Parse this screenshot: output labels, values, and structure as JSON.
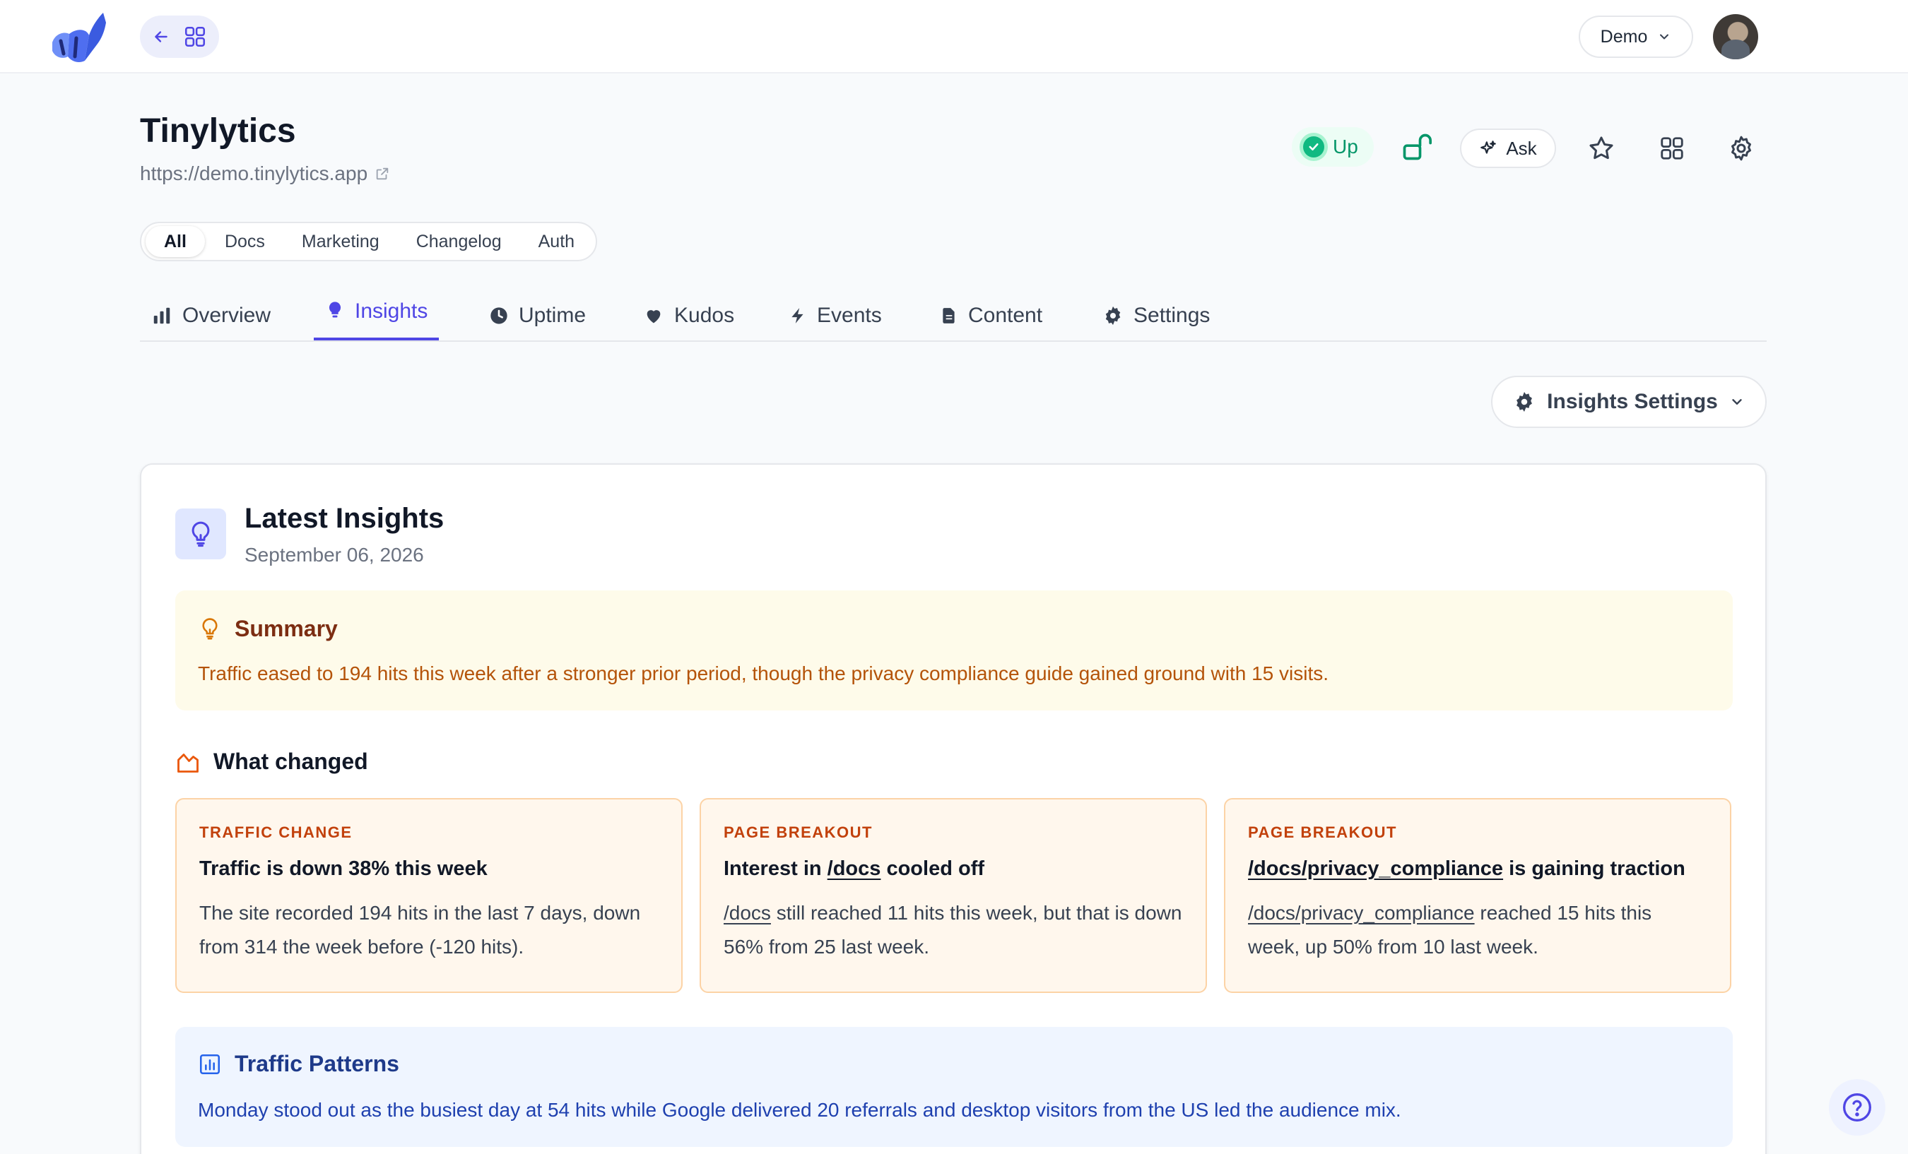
{
  "topbar": {
    "workspace": "Demo"
  },
  "site": {
    "title": "Tinylytics",
    "url": "https://demo.tinylytics.app",
    "status": "Up",
    "ask_label": "Ask"
  },
  "groups": [
    {
      "label": "All",
      "active": true
    },
    {
      "label": "Docs"
    },
    {
      "label": "Marketing"
    },
    {
      "label": "Changelog"
    },
    {
      "label": "Auth"
    }
  ],
  "tabs": [
    {
      "label": "Overview",
      "icon": "bar-chart-icon"
    },
    {
      "label": "Insights",
      "icon": "lightbulb-icon",
      "active": true
    },
    {
      "label": "Uptime",
      "icon": "clock-icon"
    },
    {
      "label": "Kudos",
      "icon": "heart-icon"
    },
    {
      "label": "Events",
      "icon": "bolt-icon"
    },
    {
      "label": "Content",
      "icon": "document-icon"
    },
    {
      "label": "Settings",
      "icon": "gear-icon"
    }
  ],
  "insights_settings_label": "Insights Settings",
  "insights": {
    "title": "Latest Insights",
    "date": "September 06, 2026",
    "summary": {
      "title": "Summary",
      "text": "Traffic eased to 194 hits this week after a stronger prior period, though the privacy compliance guide gained ground with 15 visits."
    },
    "changed_title": "What changed",
    "changes": [
      {
        "kicker": "TRAFFIC CHANGE",
        "title": "Traffic is down 38% this week",
        "body": "The site recorded 194 hits in the last 7 days, down from 314 the week before (-120 hits)."
      },
      {
        "kicker": "PAGE BREAKOUT",
        "title_prefix": "Interest in ",
        "title_link": "/docs",
        "title_suffix": " cooled off",
        "body_link": "/docs",
        "body": " still reached 11 hits this week, but that is down 56% from 25 last week."
      },
      {
        "kicker": "PAGE BREAKOUT",
        "title_link": "/docs/privacy_compliance",
        "title_suffix": " is gaining traction",
        "body_link": "/docs/privacy_compliance",
        "body": " reached 15 hits this week, up 50% from 10 last week."
      }
    ],
    "patterns": {
      "title": "Traffic Patterns",
      "text": "Monday stood out as the busiest day at 54 hits while Google delivered 20 referrals and desktop visitors from the US led the audience mix."
    }
  },
  "colors": {
    "accent": "#4f46e5",
    "up": "#059669",
    "summary_bg": "#fefbea",
    "change_bg": "#fff7ed",
    "patterns_bg": "#eff5ff"
  }
}
